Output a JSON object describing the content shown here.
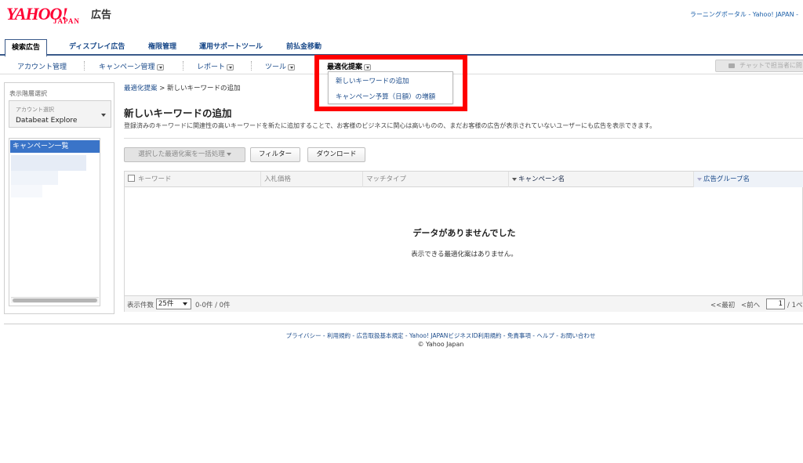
{
  "header": {
    "logo_text": "YAHOO!",
    "logo_sub": "JAPAN",
    "logo_ad": "広告",
    "top_link": "ラーニングポータル - Yahoo! JAPAN -"
  },
  "main_tabs": [
    {
      "label": "検索広告",
      "active": true
    },
    {
      "label": "ディスプレイ広告"
    },
    {
      "label": "権限管理"
    },
    {
      "label": "運用サポートツール"
    },
    {
      "label": "前払金移動"
    }
  ],
  "sub_menu": {
    "account": "アカウント管理",
    "campaign": "キャンペーン管理",
    "report": "レポート",
    "tools": "ツール",
    "optimization": "最適化提案",
    "chat": "チャットで担当者に問"
  },
  "dropdown": {
    "items": [
      "新しいキーワードの追加",
      "キャンペーン予算（日額）の増額"
    ]
  },
  "left_panel": {
    "title": "表示階層選択",
    "account_label": "アカウント選択",
    "account_value": "Databeat Explore",
    "tree_selected": "キャンペーン一覧"
  },
  "content": {
    "breadcrumb_link": "最適化提案",
    "breadcrumb_sep": ">",
    "breadcrumb_current": "新しいキーワードの追加",
    "title": "新しいキーワードの追加",
    "description": "登録済みのキーワードに関連性の高いキーワードを新たに追加することで、お客様のビジネスに関心は高いものの、まだお客様の広告が表示されていないユーザーにも広告を表示できます。",
    "buttons": {
      "bulk": "選択した最適化案を一括処理",
      "filter": "フィルター",
      "download": "ダウンロード"
    },
    "columns": [
      "キーワード",
      "入札価格",
      "マッチタイプ",
      "キャンペーン名",
      "広告グループ名"
    ],
    "empty_title": "データがありませんでした",
    "empty_message": "表示できる最適化案はありません。",
    "footer": {
      "per_page_label": "表示件数",
      "per_page_value": "25件",
      "count": "0-0件 / 0件",
      "first": "<<最初",
      "prev": "<前へ",
      "page": "1",
      "page_total": "/ 1ペ"
    }
  },
  "footer": {
    "links": "プライバシー - 利用規約 - 広告取扱基本規定 - Yahoo! JAPANビジネスID利用規約 - 免責事項 - ヘルプ - お問い合わせ",
    "copyright": "© Yahoo Japan"
  },
  "colors": {
    "brand": "#ff0033",
    "link": "#1a4a8a",
    "highlight_frame": "#ff0000",
    "selected": "#3a74c8"
  }
}
